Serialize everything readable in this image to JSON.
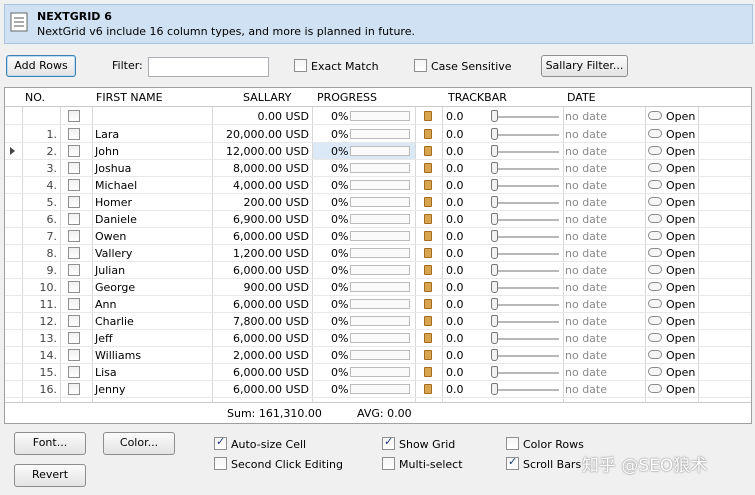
{
  "header": {
    "title": "NEXTGRID 6",
    "subtitle": "NextGrid v6 include 16 column types, and more is planned in future."
  },
  "toolbar": {
    "add_rows": "Add Rows",
    "filter_label": "Filter:",
    "filter_value": "",
    "exact_match": "Exact Match",
    "case_sensitive": "Case Sensitive",
    "sallary_filter": "Sallary Filter..."
  },
  "columns": [
    "NO.",
    "FIRST NAME",
    "SALLARY",
    "PROGRESS",
    "TRACKBAR",
    "DATE"
  ],
  "new_row": {
    "salary": "0.00 USD",
    "progress": "0%",
    "track": "0.0",
    "date": "no date",
    "open": "Open"
  },
  "rows": [
    {
      "no": "1.",
      "name": "Lara",
      "salary": "20,000.00 USD",
      "progress": "0%",
      "track": "0.0",
      "date": "no date",
      "open": "Open"
    },
    {
      "no": "2.",
      "name": "John",
      "salary": "12,000.00 USD",
      "progress": "0%",
      "track": "0.0",
      "date": "no date",
      "open": "Open"
    },
    {
      "no": "3.",
      "name": "Joshua",
      "salary": "8,000.00 USD",
      "progress": "0%",
      "track": "0.0",
      "date": "no date",
      "open": "Open"
    },
    {
      "no": "4.",
      "name": "Michael",
      "salary": "4,000.00 USD",
      "progress": "0%",
      "track": "0.0",
      "date": "no date",
      "open": "Open"
    },
    {
      "no": "5.",
      "name": "Homer",
      "salary": "200.00 USD",
      "progress": "0%",
      "track": "0.0",
      "date": "no date",
      "open": "Open"
    },
    {
      "no": "6.",
      "name": "Daniele",
      "salary": "6,900.00 USD",
      "progress": "0%",
      "track": "0.0",
      "date": "no date",
      "open": "Open"
    },
    {
      "no": "7.",
      "name": "Owen",
      "salary": "6,000.00 USD",
      "progress": "0%",
      "track": "0.0",
      "date": "no date",
      "open": "Open"
    },
    {
      "no": "8.",
      "name": "Vallery",
      "salary": "1,200.00 USD",
      "progress": "0%",
      "track": "0.0",
      "date": "no date",
      "open": "Open"
    },
    {
      "no": "9.",
      "name": "Julian",
      "salary": "6,000.00 USD",
      "progress": "0%",
      "track": "0.0",
      "date": "no date",
      "open": "Open"
    },
    {
      "no": "10.",
      "name": "George",
      "salary": "900.00 USD",
      "progress": "0%",
      "track": "0.0",
      "date": "no date",
      "open": "Open"
    },
    {
      "no": "11.",
      "name": "Ann",
      "salary": "6,000.00 USD",
      "progress": "0%",
      "track": "0.0",
      "date": "no date",
      "open": "Open"
    },
    {
      "no": "12.",
      "name": "Charlie",
      "salary": "7,800.00 USD",
      "progress": "0%",
      "track": "0.0",
      "date": "no date",
      "open": "Open"
    },
    {
      "no": "13.",
      "name": "Jeff",
      "salary": "6,000.00 USD",
      "progress": "0%",
      "track": "0.0",
      "date": "no date",
      "open": "Open"
    },
    {
      "no": "14.",
      "name": "Williams",
      "salary": "2,000.00 USD",
      "progress": "0%",
      "track": "0.0",
      "date": "no date",
      "open": "Open"
    },
    {
      "no": "15.",
      "name": "Lisa",
      "salary": "6,000.00 USD",
      "progress": "0%",
      "track": "0.0",
      "date": "no date",
      "open": "Open"
    },
    {
      "no": "16.",
      "name": "Jenny",
      "salary": "6,000.00 USD",
      "progress": "0%",
      "track": "0.0",
      "date": "no date",
      "open": "Open"
    }
  ],
  "footer": {
    "sum": "Sum: 161,310.00",
    "avg": "AVG: 0.00"
  },
  "options": {
    "font": "Font...",
    "color": "Color...",
    "revert": "Revert",
    "auto_size_cell": "Auto-size Cell",
    "second_click_editing": "Second Click Editing",
    "show_grid": "Show Grid",
    "multi_select": "Multi-select",
    "color_rows": "Color Rows",
    "scroll_bars": "Scroll Bars"
  },
  "watermark": "知乎 @SEO狼术"
}
